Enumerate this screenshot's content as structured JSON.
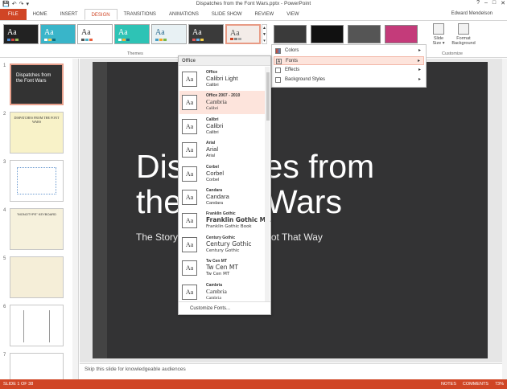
{
  "window": {
    "title": "Dispatches from the Font Wars.pptx - PowerPoint",
    "user": "Edward Mendelson"
  },
  "qat": {
    "save": "💾",
    "undo": "↶",
    "redo": "↷",
    "more": "▾"
  },
  "tabs": [
    "FILE",
    "HOME",
    "INSERT",
    "DESIGN",
    "TRANSITIONS",
    "ANIMATIONS",
    "SLIDE SHOW",
    "REVIEW",
    "VIEW"
  ],
  "ribbon": {
    "themes_label": "Themes",
    "customize_label": "Customize",
    "slide_size": "Slide Size ▾",
    "format_background": "Format Background",
    "theme_sample": "Aa"
  },
  "thumbnails": [
    {
      "num": "1",
      "title": "Dispatches from the Font Wars"
    },
    {
      "num": "2",
      "title": "DISPATCHES FROM THE FONT WARS"
    },
    {
      "num": "3",
      "title": ""
    },
    {
      "num": "4",
      "title": "\"MONOTYPE\" KEYBOARD"
    },
    {
      "num": "5",
      "title": ""
    },
    {
      "num": "6",
      "title": ""
    },
    {
      "num": "7",
      "title": ""
    }
  ],
  "slide": {
    "title_line1": "Dispatches from",
    "title_line2": "the Font Wars",
    "subtitle": "The Story of Type and How It Got That Way"
  },
  "notes": "Skip this slide for knowledgeable audiences",
  "status": {
    "slide": "SLIDE 1 OF 38",
    "notes": "NOTES",
    "comments": "COMMENTS",
    "zoom": "73%"
  },
  "fonts_dropdown": {
    "header": "Office",
    "items": [
      {
        "name": "Office",
        "heading": "Calibri Light",
        "body": "Calibri"
      },
      {
        "name": "Office 2007 - 2010",
        "heading": "Cambria",
        "body": "Calibri"
      },
      {
        "name": "Calibri",
        "heading": "Calibri",
        "body": "Calibri"
      },
      {
        "name": "Arial",
        "heading": "Arial",
        "body": "Arial"
      },
      {
        "name": "Corbel",
        "heading": "Corbel",
        "body": "Corbel"
      },
      {
        "name": "Candara",
        "heading": "Candara",
        "body": "Candara"
      },
      {
        "name": "Franklin Gothic",
        "heading": "Franklin Gothic M...",
        "body": "Franklin Gothic Book"
      },
      {
        "name": "Century Gothic",
        "heading": "Century Gothic",
        "body": "Century Gothic"
      },
      {
        "name": "Tw Cen MT",
        "heading": "Tw Cen MT",
        "body": "Tw Cen MT"
      },
      {
        "name": "Cambria",
        "heading": "Cambria",
        "body": "Cambria"
      }
    ],
    "icon_text": "Aa",
    "footer": "Customize Fonts..."
  },
  "variants_menu": {
    "items": [
      "Colors",
      "Fonts",
      "Effects",
      "Background Styles"
    ]
  },
  "colors": {
    "accent": "#d04525",
    "slide_bg": "#333334",
    "hover": "#fde4dc"
  }
}
